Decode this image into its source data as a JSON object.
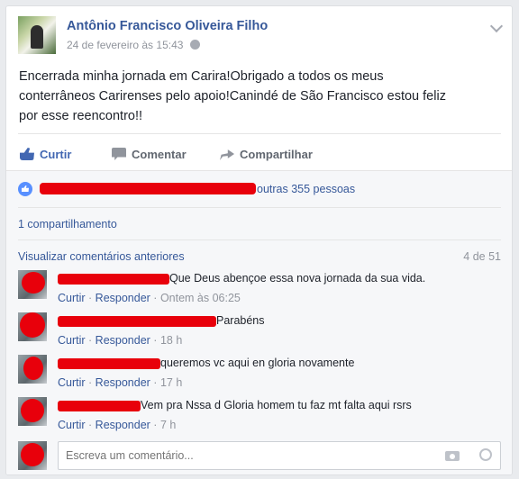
{
  "post": {
    "author": "Antônio Francisco Oliveira Filho",
    "timestamp": "24 de fevereiro às 15:43",
    "privacy_icon": "globe-icon",
    "text_lines": [
      "Encerrada minha jornada em Carira!Obrigado a todos os meus",
      "conterrâneos Carirenses pelo apoio!Canindé de São Francisco estou feliz",
      "por esse reencontro!!"
    ]
  },
  "actions": {
    "like": "Curtir",
    "comment": "Comentar",
    "share": "Compartilhar"
  },
  "reactions": {
    "likes_text": "outras 355 pessoas",
    "shares": "1 compartilhamento"
  },
  "comments_header": {
    "previous_link": "Visualizar comentários anteriores",
    "count": "4 de 51"
  },
  "comments": [
    {
      "text": "Que Deus abençoe essa nova jornada da sua vida.",
      "like": "Curtir",
      "reply": "Responder",
      "time": "Ontem às 06:25"
    },
    {
      "text": "Parabéns",
      "like": "Curtir",
      "reply": "Responder",
      "time": "18 h"
    },
    {
      "text": "queremos vc aqui en gloria novamente",
      "like": "Curtir",
      "reply": "Responder",
      "time": "17 h"
    },
    {
      "text": "Vem pra Nssa d Gloria homem tu faz mt falta aqui rsrs",
      "like": "Curtir",
      "reply": "Responder",
      "time": "7 h"
    }
  ],
  "compose": {
    "placeholder": "Escreva um comentário...",
    "camera_icon": "camera-icon",
    "emoji_icon": "emoji-icon"
  },
  "colors": {
    "link": "#365899",
    "like_blue": "#4267b2",
    "redaction": "#e8000b"
  }
}
